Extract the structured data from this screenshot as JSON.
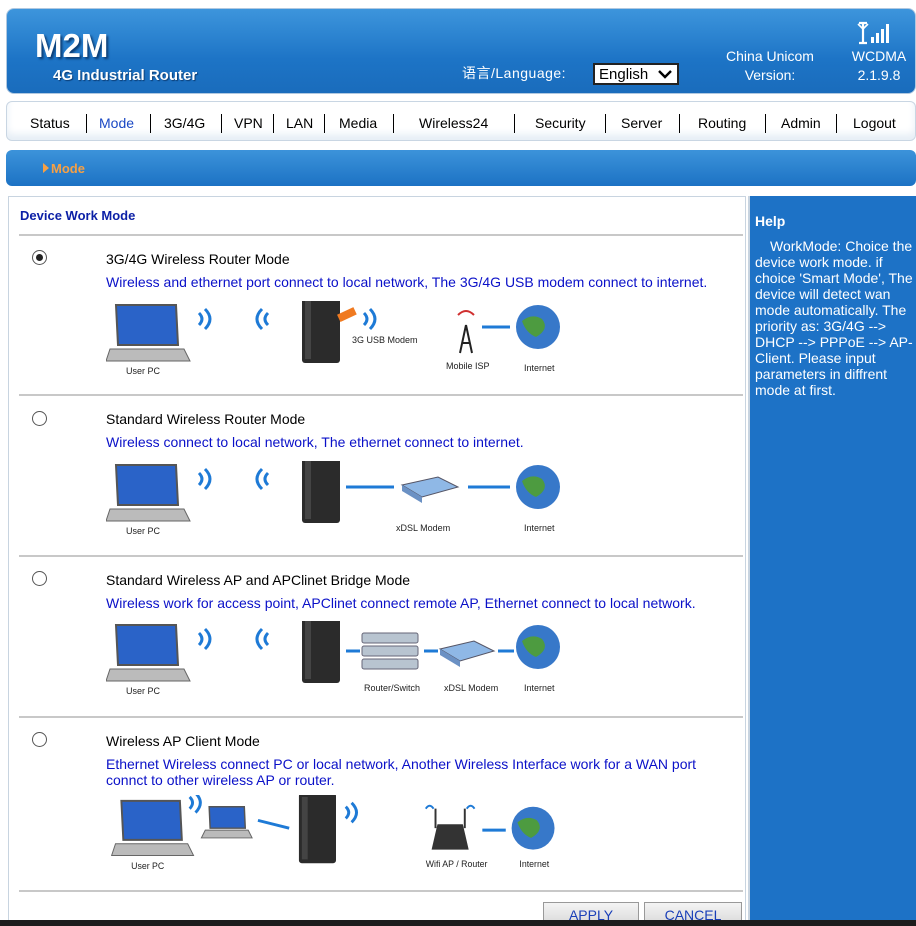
{
  "header": {
    "logo": "M2M",
    "subtitle": "4G Industrial Router",
    "language_label": "语言/Language:",
    "language_selected": "English",
    "carrier": "China Unicom",
    "version_label": "Version:",
    "network": "WCDMA",
    "version": "2.1.9.8"
  },
  "nav": [
    {
      "label": "Status"
    },
    {
      "label": "Mode"
    },
    {
      "label": "3G/4G"
    },
    {
      "label": "VPN"
    },
    {
      "label": "LAN"
    },
    {
      "label": "Media"
    },
    {
      "label": "Wireless24"
    },
    {
      "label": "Security"
    },
    {
      "label": "Server"
    },
    {
      "label": "Routing"
    },
    {
      "label": "Admin"
    },
    {
      "label": "Logout"
    }
  ],
  "section": {
    "title": "Mode"
  },
  "content": {
    "title": "Device Work Mode",
    "modes": [
      {
        "name": "3G/4G Wireless Router Mode",
        "desc": "Wireless and ethernet port connect to local network, The 3G/4G USB modem connect to internet.",
        "checked": true,
        "labels": [
          "User PC",
          "3G USB Modem",
          "Mobile ISP",
          "Internet"
        ]
      },
      {
        "name": "Standard Wireless Router Mode",
        "desc": "Wireless connect to local network, The ethernet connect to internet.",
        "checked": false,
        "labels": [
          "User PC",
          "xDSL Modem",
          "Internet"
        ]
      },
      {
        "name": "Standard Wireless AP and APClinet Bridge Mode",
        "desc": "Wireless work for access point, APClinet connect remote AP, Ethernet connect to local network.",
        "checked": false,
        "labels": [
          "User PC",
          "Router/Switch",
          "xDSL Modem",
          "Internet"
        ]
      },
      {
        "name": "Wireless AP Client Mode",
        "desc": "Ethernet Wireless connect PC or local network, Another Wireless Interface work for a WAN port connct to other wireless AP or router.",
        "checked": false,
        "labels": [
          "User PC",
          "Wifi AP / Router",
          "Internet"
        ]
      }
    ],
    "apply_label": "APPLY",
    "cancel_label": "CANCEL"
  },
  "help": {
    "title": "Help",
    "text": "WorkMode: Choice the device work mode. if choice 'Smart Mode', The device will detect wan mode automatically. The priority as: 3G/4G --> DHCP --> PPPoE --> AP-Client. Please input parameters in diffrent mode at first."
  },
  "colors": {
    "header_blue": "#1d74c6",
    "nav_active": "#1a48c4",
    "section_title": "#f7a044",
    "desc_text": "#0a10c8",
    "content_title": "#0b1fa6"
  }
}
